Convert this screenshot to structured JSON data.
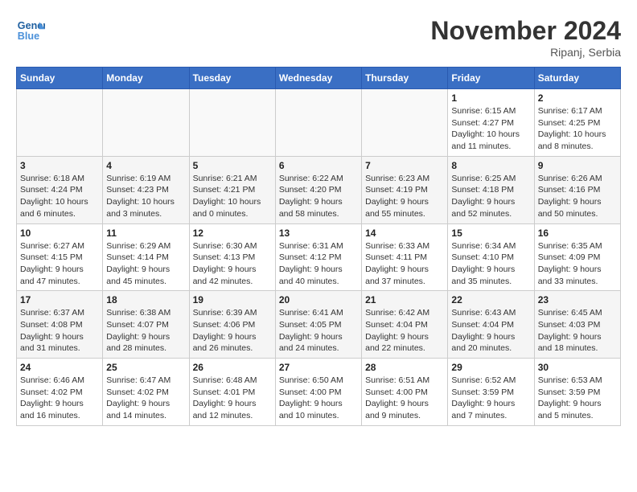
{
  "header": {
    "logo_line1": "General",
    "logo_line2": "Blue",
    "month_title": "November 2024",
    "location": "Ripanj, Serbia"
  },
  "days_of_week": [
    "Sunday",
    "Monday",
    "Tuesday",
    "Wednesday",
    "Thursday",
    "Friday",
    "Saturday"
  ],
  "weeks": [
    [
      {
        "day": "",
        "info": ""
      },
      {
        "day": "",
        "info": ""
      },
      {
        "day": "",
        "info": ""
      },
      {
        "day": "",
        "info": ""
      },
      {
        "day": "",
        "info": ""
      },
      {
        "day": "1",
        "info": "Sunrise: 6:15 AM\nSunset: 4:27 PM\nDaylight: 10 hours and 11 minutes."
      },
      {
        "day": "2",
        "info": "Sunrise: 6:17 AM\nSunset: 4:25 PM\nDaylight: 10 hours and 8 minutes."
      }
    ],
    [
      {
        "day": "3",
        "info": "Sunrise: 6:18 AM\nSunset: 4:24 PM\nDaylight: 10 hours and 6 minutes."
      },
      {
        "day": "4",
        "info": "Sunrise: 6:19 AM\nSunset: 4:23 PM\nDaylight: 10 hours and 3 minutes."
      },
      {
        "day": "5",
        "info": "Sunrise: 6:21 AM\nSunset: 4:21 PM\nDaylight: 10 hours and 0 minutes."
      },
      {
        "day": "6",
        "info": "Sunrise: 6:22 AM\nSunset: 4:20 PM\nDaylight: 9 hours and 58 minutes."
      },
      {
        "day": "7",
        "info": "Sunrise: 6:23 AM\nSunset: 4:19 PM\nDaylight: 9 hours and 55 minutes."
      },
      {
        "day": "8",
        "info": "Sunrise: 6:25 AM\nSunset: 4:18 PM\nDaylight: 9 hours and 52 minutes."
      },
      {
        "day": "9",
        "info": "Sunrise: 6:26 AM\nSunset: 4:16 PM\nDaylight: 9 hours and 50 minutes."
      }
    ],
    [
      {
        "day": "10",
        "info": "Sunrise: 6:27 AM\nSunset: 4:15 PM\nDaylight: 9 hours and 47 minutes."
      },
      {
        "day": "11",
        "info": "Sunrise: 6:29 AM\nSunset: 4:14 PM\nDaylight: 9 hours and 45 minutes."
      },
      {
        "day": "12",
        "info": "Sunrise: 6:30 AM\nSunset: 4:13 PM\nDaylight: 9 hours and 42 minutes."
      },
      {
        "day": "13",
        "info": "Sunrise: 6:31 AM\nSunset: 4:12 PM\nDaylight: 9 hours and 40 minutes."
      },
      {
        "day": "14",
        "info": "Sunrise: 6:33 AM\nSunset: 4:11 PM\nDaylight: 9 hours and 37 minutes."
      },
      {
        "day": "15",
        "info": "Sunrise: 6:34 AM\nSunset: 4:10 PM\nDaylight: 9 hours and 35 minutes."
      },
      {
        "day": "16",
        "info": "Sunrise: 6:35 AM\nSunset: 4:09 PM\nDaylight: 9 hours and 33 minutes."
      }
    ],
    [
      {
        "day": "17",
        "info": "Sunrise: 6:37 AM\nSunset: 4:08 PM\nDaylight: 9 hours and 31 minutes."
      },
      {
        "day": "18",
        "info": "Sunrise: 6:38 AM\nSunset: 4:07 PM\nDaylight: 9 hours and 28 minutes."
      },
      {
        "day": "19",
        "info": "Sunrise: 6:39 AM\nSunset: 4:06 PM\nDaylight: 9 hours and 26 minutes."
      },
      {
        "day": "20",
        "info": "Sunrise: 6:41 AM\nSunset: 4:05 PM\nDaylight: 9 hours and 24 minutes."
      },
      {
        "day": "21",
        "info": "Sunrise: 6:42 AM\nSunset: 4:04 PM\nDaylight: 9 hours and 22 minutes."
      },
      {
        "day": "22",
        "info": "Sunrise: 6:43 AM\nSunset: 4:04 PM\nDaylight: 9 hours and 20 minutes."
      },
      {
        "day": "23",
        "info": "Sunrise: 6:45 AM\nSunset: 4:03 PM\nDaylight: 9 hours and 18 minutes."
      }
    ],
    [
      {
        "day": "24",
        "info": "Sunrise: 6:46 AM\nSunset: 4:02 PM\nDaylight: 9 hours and 16 minutes."
      },
      {
        "day": "25",
        "info": "Sunrise: 6:47 AM\nSunset: 4:02 PM\nDaylight: 9 hours and 14 minutes."
      },
      {
        "day": "26",
        "info": "Sunrise: 6:48 AM\nSunset: 4:01 PM\nDaylight: 9 hours and 12 minutes."
      },
      {
        "day": "27",
        "info": "Sunrise: 6:50 AM\nSunset: 4:00 PM\nDaylight: 9 hours and 10 minutes."
      },
      {
        "day": "28",
        "info": "Sunrise: 6:51 AM\nSunset: 4:00 PM\nDaylight: 9 hours and 9 minutes."
      },
      {
        "day": "29",
        "info": "Sunrise: 6:52 AM\nSunset: 3:59 PM\nDaylight: 9 hours and 7 minutes."
      },
      {
        "day": "30",
        "info": "Sunrise: 6:53 AM\nSunset: 3:59 PM\nDaylight: 9 hours and 5 minutes."
      }
    ]
  ]
}
